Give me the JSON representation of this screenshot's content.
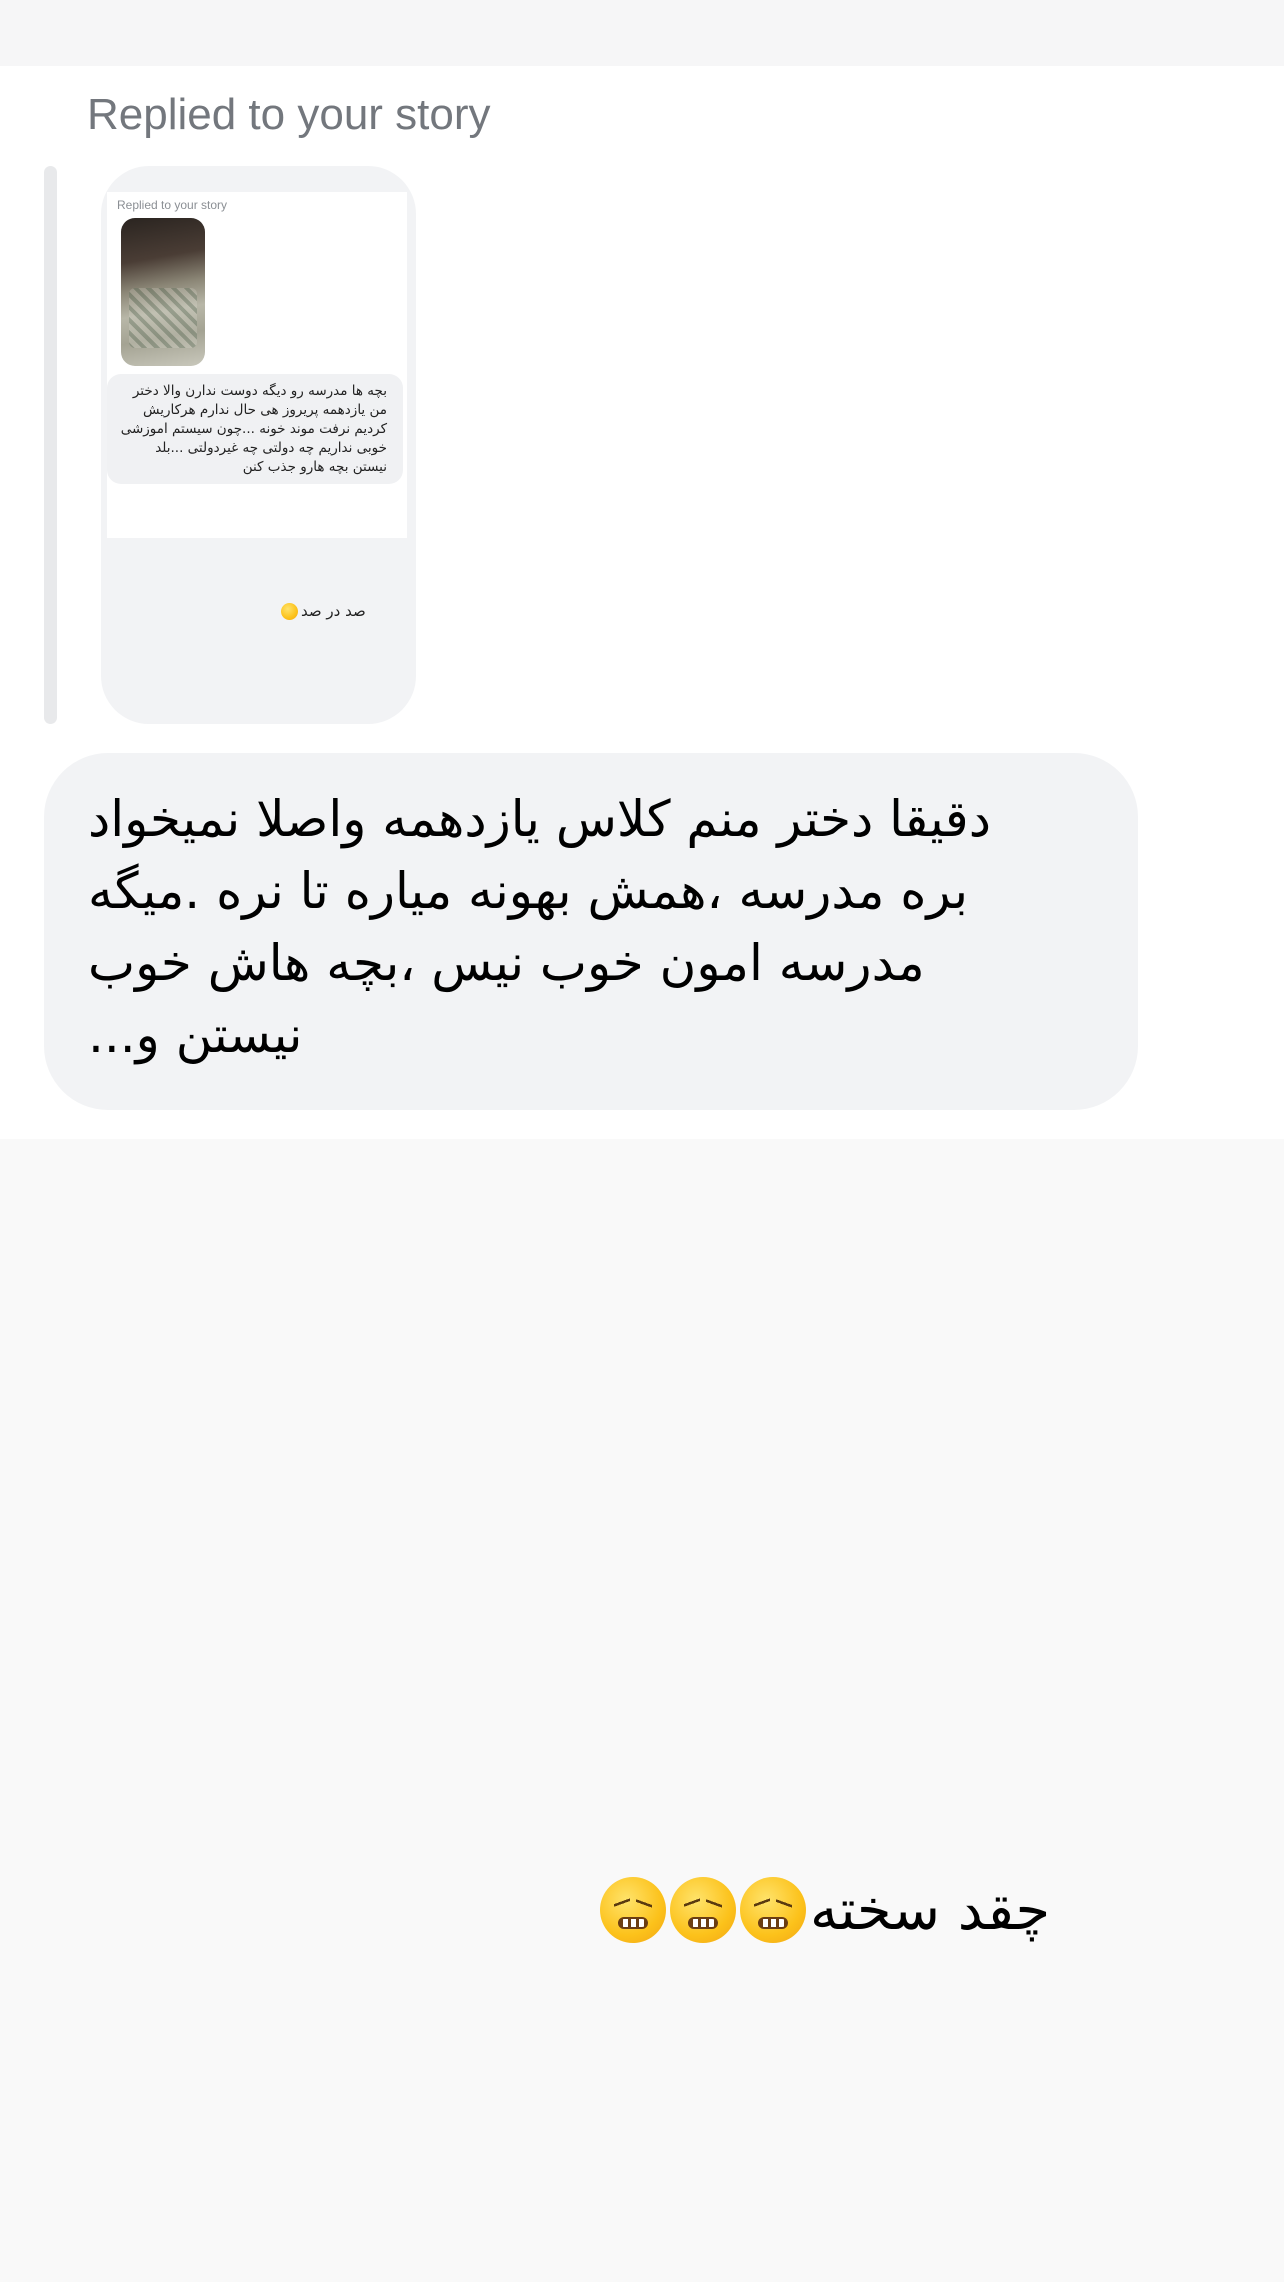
{
  "story_reply": {
    "header": "Replied to your story",
    "thumbnail": {
      "inner_header": "Replied to your story",
      "inner_message": "بچه ها مدرسه رو دیگه دوست ندارن والا دختر\nمن یازدهمه پریروز هی حال ندارم هرکاریش\nکردیم نرفت موند خونه ...چون سیستم اموزشی\nخوبی نداریم چه دولتی چه غیردولتی ...بلد\nنیستن بچه هارو جذب کنن",
      "caption": "صد در صد",
      "caption_emoji": "disappointed-face-icon"
    }
  },
  "messages": [
    {
      "text": "دقیقا دختر منم کلاس یازدهمه واصلا نمیخواد\nبره مدرسه ،همش بهونه میاره تا نره .میگه\nمدرسه امون خوب نیس ،بچه هاش خوب\nنیستن و..."
    }
  ],
  "reply": {
    "text": "چقد سخته",
    "emojis": [
      "confounded-face-icon",
      "confounded-face-icon",
      "tired-face-icon"
    ]
  },
  "colors": {
    "bubble_bg": "#f2f3f5",
    "header_text": "#73777d",
    "background": "#f9f9f9"
  }
}
